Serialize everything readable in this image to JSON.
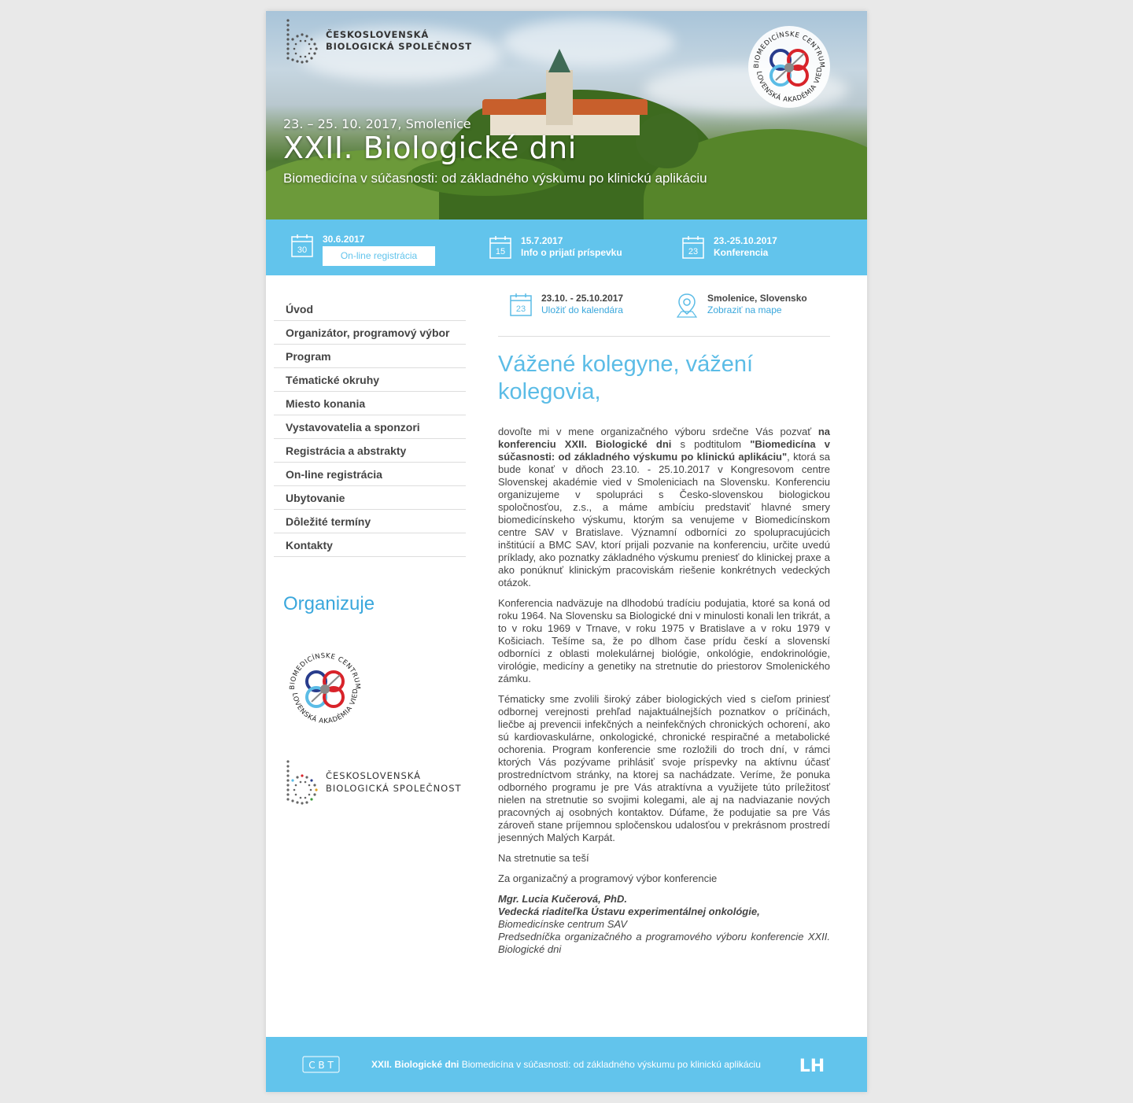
{
  "header": {
    "logo_cbs": {
      "line1": "ČESKOSLOVENSKÁ",
      "line2": "BIOLOGICKÁ SPOLEČNOST"
    },
    "logo_bmc": {
      "top": "BIOMEDICÍNSKE CENTRUM",
      "bottom": "SLOVENSKÁ AKADÉMIA VIED"
    },
    "event_date": "23. – 25. 10. 2017, Smolenice",
    "title": "XXII. Biologické dni",
    "subtitle": "Biomedicína v súčasnosti: od základného výskumu po klinickú aplikáciu"
  },
  "deadlines": [
    {
      "day": "30",
      "date": "30.6.2017",
      "button": "On-line registrácia"
    },
    {
      "day": "15",
      "date": "15.7.2017",
      "label": "Info o prijatí príspevku"
    },
    {
      "day": "23",
      "date": "23.-25.10.2017",
      "label": "Konferencia"
    }
  ],
  "nav": {
    "items": [
      "Úvod",
      "Organizátor, programový výbor",
      "Program",
      "Tématické okruhy",
      "Miesto konania",
      "Vystavovatelia a sponzori",
      "Registrácia a abstrakty",
      "On-line registrácia",
      "Ubytovanie",
      "Dôležité termíny",
      "Kontakty"
    ]
  },
  "sidebar": {
    "organizer_title": "Organizuje"
  },
  "info": {
    "calendar": {
      "day": "23",
      "dates": "23.10. - 25.10.2017",
      "link": "Uložiť do kalendára"
    },
    "location": {
      "place": "Smolenice, Slovensko",
      "link": "Zobraziť na mape"
    }
  },
  "main": {
    "greeting": "Vážené kolegyne, vážení kolegovia,",
    "p1_a": "dovoľte mi v mene organizačného výboru srdečne Vás pozvať ",
    "p1_b": "na konferenciu XXII. Biologické dni",
    "p1_c": " s podtitulom ",
    "p1_d": "\"Biomedicína v súčasnosti: od základného výskumu po klinickú aplikáciu\"",
    "p1_e": ", ktorá sa bude konať v dňoch 23.10. - 25.10.2017 v Kongresovom centre Slovenskej akadémie vied v Smoleniciach na Slovensku. Konferenciu organizujeme v spolupráci s Česko-slovenskou biologickou spoločnosťou, z.s., a máme ambíciu predstaviť hlavné smery biomedicínskeho výskumu, ktorým sa venujeme v Biomedicínskom centre SAV v Bratislave. Významní odborníci zo spolupracujúcich inštitúcií a BMC SAV, ktorí prijali pozvanie na konferenciu, určite uvedú príklady, ako poznatky základného výskumu preniesť do klinickej praxe a ako ponúknuť klinickým pracoviskám riešenie konkrétnych vedeckých otázok.",
    "p2": "Konferencia nadväzuje na dlhodobú tradíciu podujatia, ktoré sa koná od roku 1964. Na Slovensku sa Biologické dni v minulosti konali len trikrát, a to v roku 1969 v Trnave, v roku 1975 v Bratislave a v roku 1979 v Košiciach. Tešíme sa, že po dlhom čase prídu českí a slovenskí odborníci z oblasti molekulárnej biológie, onkológie, endokrinológie, virológie, medicíny a genetiky na stretnutie do priestorov Smolenického zámku.",
    "p3": "Tématicky sme zvolili široký záber biologických vied s cieľom priniesť odbornej verejnosti prehľad najaktuálnejších poznatkov o príčinách, liečbe aj prevencii infekčných a neinfekčných chronických ochorení, ako sú kardiovaskulárne, onkologické, chronické respiračné a metabolické ochorenia. Program konferencie sme rozložili do troch dní, v rámci ktorých Vás pozývame prihlásiť svoje príspevky na aktívnu účasť prostredníctvom stránky, na ktorej sa nachádzate. Veríme, že ponuka odborného programu je pre Vás atraktívna a využijete túto príležitosť nielen na stretnutie so svojimi kolegami, ale aj na nadviazanie nových pracovných aj osobných kontaktov. Dúfame, že podujatie sa pre Vás zároveň stane príjemnou spločenskou udalosťou v prekrásnom prostredí jesenných Malých Karpát.",
    "p4": "Na stretnutie sa teší",
    "p5": "Za organizačný a programový výbor konferencie",
    "sig_name": "Mgr. Lucia Kučerová, PhD.",
    "sig_role": "Vedecká riaditeľka Ústavu experimentálnej onkológie,",
    "sig_inst": "Biomedicínske centrum SAV",
    "sig_chair": "Predsedníčka organizačného a programového výboru konferencie XXII. Biologické dni"
  },
  "footer": {
    "title": "XXII. Biologické dni",
    "subtitle": "Biomedicína v súčasnosti: od základného výskumu po klinickú aplikáciu",
    "left_logo": "C B T",
    "right_logo": "LH"
  },
  "colors": {
    "accent": "#62c4ec",
    "heading": "#5bbce6",
    "link": "#3aa7dc"
  }
}
